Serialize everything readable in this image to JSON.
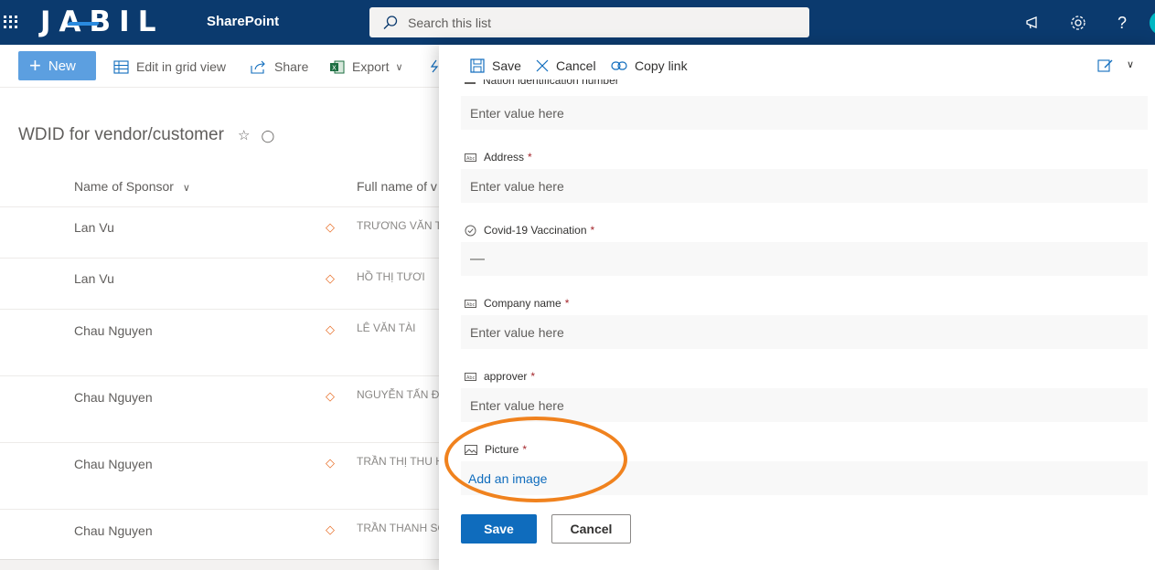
{
  "suitebar": {
    "brand": "JABIL",
    "app_name": "SharePoint",
    "search_placeholder": "Search this list",
    "help_label": "?"
  },
  "commandbar": {
    "new_label": "New",
    "edit_grid_label": "Edit in grid view",
    "share_label": "Share",
    "export_label": "Export"
  },
  "list": {
    "title": "WDID for vendor/customer",
    "columns": [
      "Name of Sponsor",
      "Full name of v"
    ],
    "rows": [
      {
        "sponsor": "Lan Vu",
        "fullname": "TRƯƠNG VĂN TI"
      },
      {
        "sponsor": "Lan Vu",
        "fullname": "HỒ THỊ TƯƠI"
      },
      {
        "sponsor": "Chau Nguyen",
        "fullname": "LÊ VĂN TÀI"
      },
      {
        "sponsor": "Chau Nguyen",
        "fullname": "NGUYỄN TẤN ĐẠ"
      },
      {
        "sponsor": "Chau Nguyen",
        "fullname": "TRẦN THỊ THU H"
      },
      {
        "sponsor": "Chau Nguyen",
        "fullname": "TRẦN THANH SƠ"
      }
    ]
  },
  "panel": {
    "save_label": "Save",
    "cancel_label": "Cancel",
    "copy_link_label": "Copy link",
    "cut_label": "Nation identification number",
    "fields": [
      {
        "label": "Address",
        "required": "*",
        "value": "Enter value here"
      },
      {
        "label": "Covid-19 Vaccination",
        "required": "*",
        "value": "—"
      },
      {
        "label": "Company name",
        "required": "*",
        "value": "Enter value here"
      },
      {
        "label": "approver",
        "required": "*",
        "value": "Enter value here"
      },
      {
        "label": "Picture",
        "required": "*",
        "value": "Add an image"
      }
    ],
    "top_value": "Enter value here",
    "footer_save": "Save",
    "footer_cancel": "Cancel"
  },
  "colors": {
    "suitebar": "#0b3a6e",
    "primary": "#0f6cbd",
    "highlight": "#f0821e",
    "required": "#a4262c"
  }
}
